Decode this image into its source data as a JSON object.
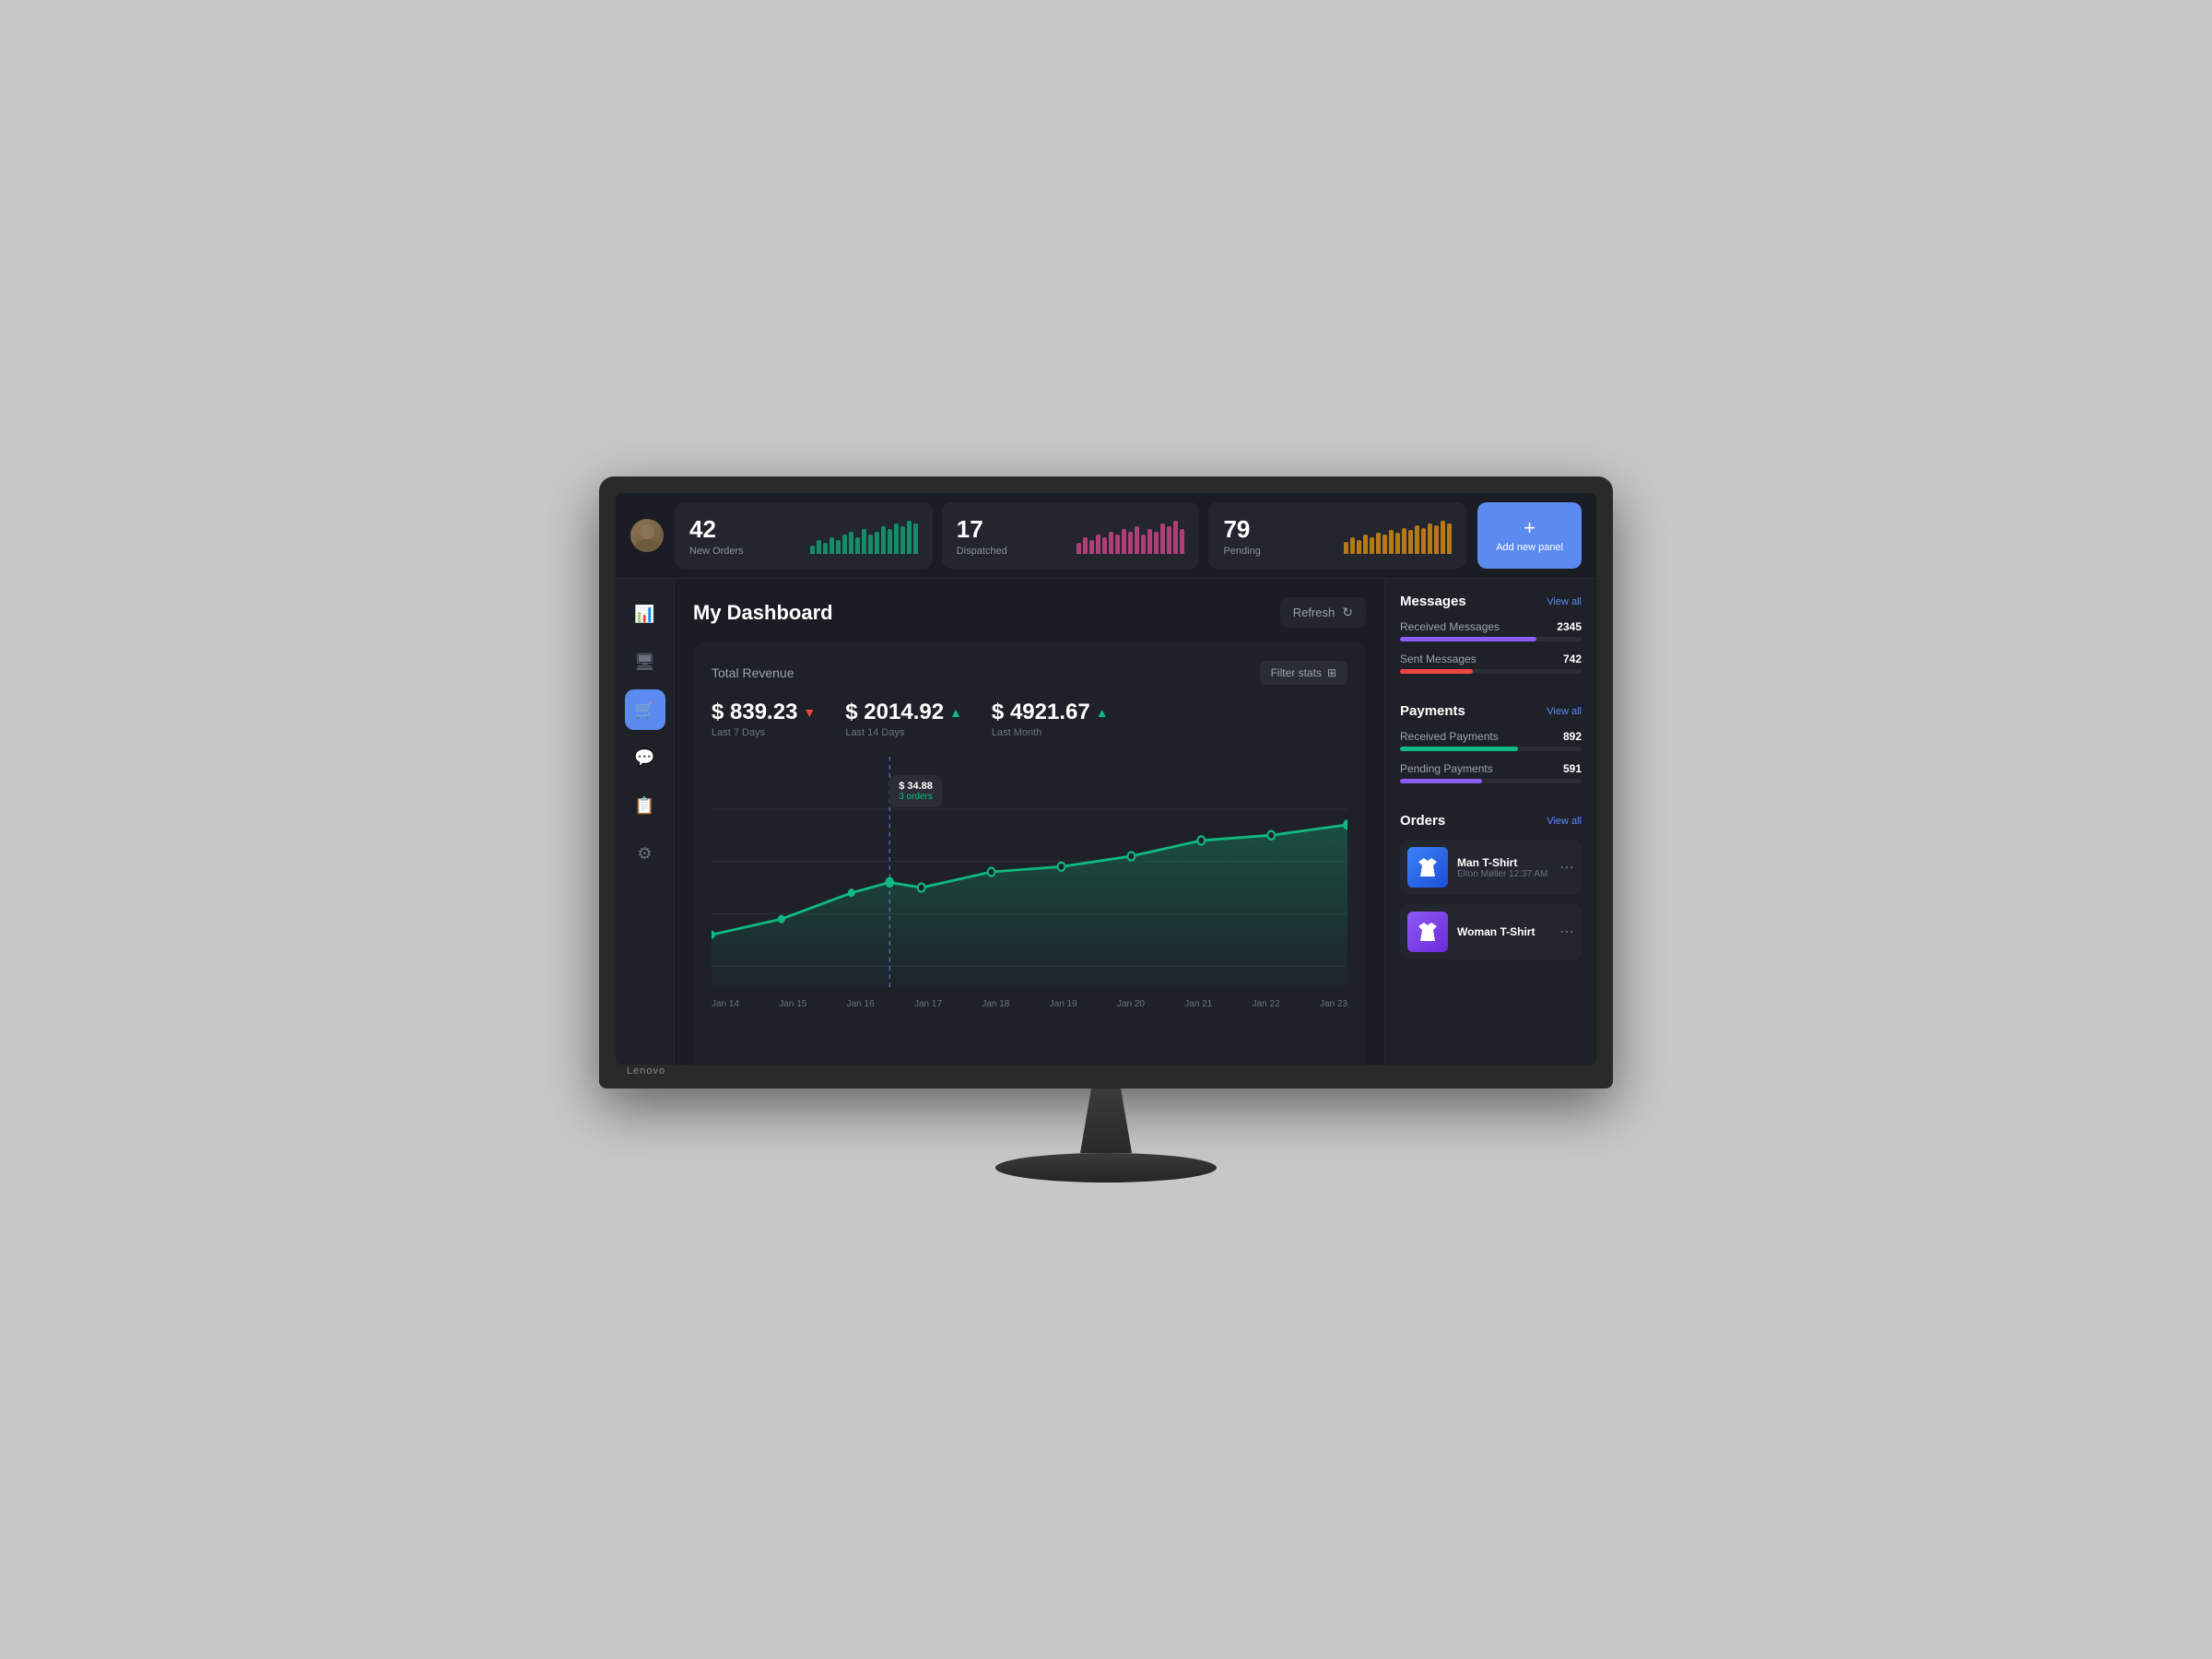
{
  "monitor": {
    "brand": "Lenovo"
  },
  "topStats": [
    {
      "id": "new-orders",
      "number": "42",
      "label": "New Orders",
      "color": "#10b981",
      "bars": [
        3,
        5,
        4,
        6,
        5,
        7,
        8,
        6,
        9,
        7,
        8,
        10,
        9,
        11,
        10,
        12,
        11
      ]
    },
    {
      "id": "dispatched",
      "number": "17",
      "label": "Dispatched",
      "color": "#ec4899",
      "bars": [
        4,
        6,
        5,
        7,
        6,
        8,
        7,
        9,
        8,
        10,
        7,
        9,
        8,
        11,
        10,
        12,
        9
      ]
    },
    {
      "id": "pending",
      "number": "79",
      "label": "Pending",
      "color": "#f59e0b",
      "bars": [
        5,
        7,
        6,
        8,
        7,
        9,
        8,
        10,
        9,
        11,
        10,
        12,
        11,
        13,
        12,
        14,
        13
      ]
    }
  ],
  "addPanelBtn": {
    "plus": "+",
    "label": "Add new panel"
  },
  "sidebar": {
    "icons": [
      {
        "name": "chart-icon",
        "symbol": "📊",
        "active": false
      },
      {
        "name": "presentation-icon",
        "symbol": "🖥",
        "active": false
      },
      {
        "name": "shop-icon",
        "symbol": "🛒",
        "active": true
      },
      {
        "name": "chat-icon",
        "symbol": "💬",
        "active": false
      },
      {
        "name": "document-icon",
        "symbol": "📋",
        "active": false
      },
      {
        "name": "settings-icon",
        "symbol": "⚙",
        "active": false
      }
    ]
  },
  "dashboard": {
    "title": "My Dashboard",
    "refreshLabel": "Refresh",
    "chart": {
      "title": "Total Revenue",
      "filterLabel": "Filter stats",
      "revenues": [
        {
          "value": "$ 839.23",
          "period": "Last 7 Days",
          "trend": "down"
        },
        {
          "value": "$ 2014.92",
          "period": "Last 14 Days",
          "trend": "up"
        },
        {
          "value": "$ 4921.67",
          "period": "Last Month",
          "trend": "up"
        }
      ],
      "tooltip": {
        "value": "$ 34.88",
        "sub": "3 orders"
      },
      "xLabels": [
        "Jan 14",
        "Jan 15",
        "Jan 16",
        "Jan 17",
        "Jan 18",
        "Jan 19",
        "Jan 20",
        "Jan 21",
        "Jan 22",
        "Jan 23"
      ]
    }
  },
  "rightPanel": {
    "messages": {
      "title": "Messages",
      "viewAll": "View all",
      "items": [
        {
          "label": "Received Messages",
          "value": "2345",
          "color": "#8b5cf6",
          "percent": 75
        },
        {
          "label": "Sent Messages",
          "value": "742",
          "color": "#ef4444",
          "percent": 40
        }
      ]
    },
    "payments": {
      "title": "Payments",
      "viewAll": "View all",
      "items": [
        {
          "label": "Received Payments",
          "value": "892",
          "color": "#10b981",
          "percent": 65
        },
        {
          "label": "Pending Payments",
          "value": "591",
          "color": "#8b5cf6",
          "percent": 45
        }
      ]
    },
    "orders": {
      "title": "Orders",
      "viewAll": "View all",
      "items": [
        {
          "name": "Man T-Shirt",
          "sub": "Elton Møller  12:37 AM",
          "color": "blue"
        },
        {
          "name": "Woman T-Shirt",
          "sub": "",
          "color": "purple"
        }
      ]
    }
  }
}
